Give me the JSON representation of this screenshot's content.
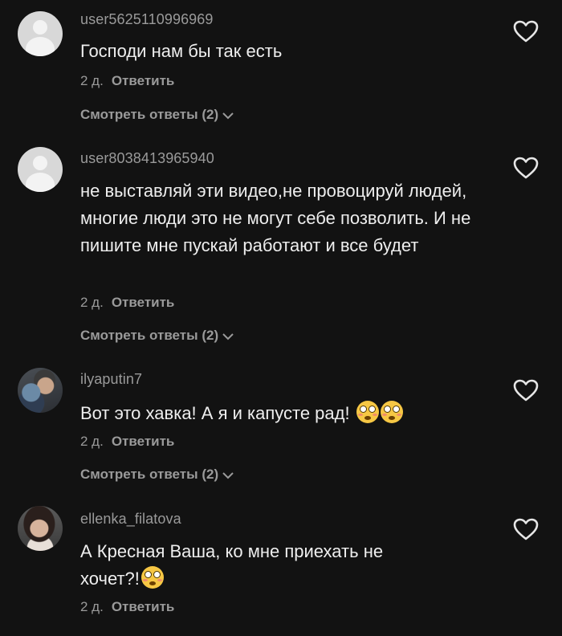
{
  "comments": [
    {
      "username": "user5625110996969",
      "text": "Господи нам бы так есть",
      "time": "2 д.",
      "reply_label": "Ответить",
      "view_replies": "Смотреть ответы (2)"
    },
    {
      "username": "user8038413965940",
      "text": "не выставляй эти видео,не провоцируй людей, многие люди это не могут себе позволить. И не пишите мне пускай работают и все будет",
      "time": "2 д.",
      "reply_label": "Ответить",
      "view_replies": "Смотреть ответы (2)"
    },
    {
      "username": "ilyaputin7",
      "text": "Вот это хавка! А я и капусте рад!",
      "time": "2 д.",
      "reply_label": "Ответить",
      "view_replies": "Смотреть ответы (2)"
    },
    {
      "username": "ellenka_filatova",
      "text": "А Кресная Ваша, ко мне приехать не хочет?!",
      "time": "2 д.",
      "reply_label": "Ответить"
    }
  ],
  "icons": {
    "like": "heart-outline-icon",
    "expand": "chevron-down-icon",
    "emoji": "flushed-face-emoji"
  },
  "colors": {
    "background": "#121212",
    "primary_text": "#eeeeee",
    "secondary_text": "#9a9a9a"
  }
}
